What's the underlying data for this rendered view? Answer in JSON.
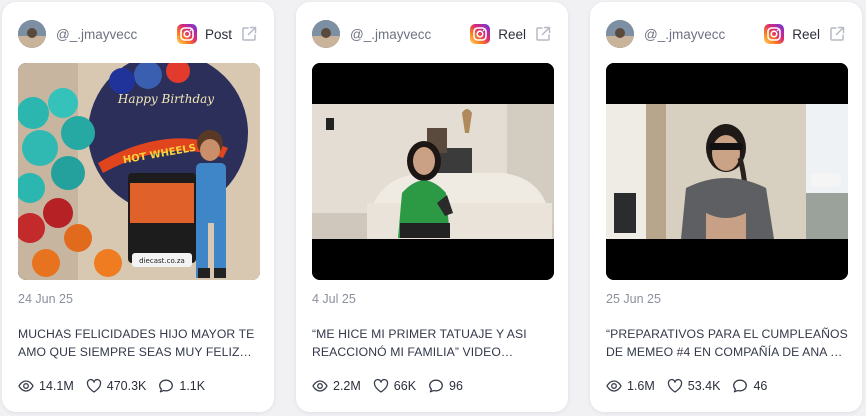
{
  "cards": [
    {
      "handle": "@_.jmayvecc",
      "type_label": "Post",
      "date": "24 Jun 25",
      "caption": "MUCHAS FELICIDADES HIJO MAYOR TE AMO QUE SIEMPRE SEAS MUY FELIZ COMO ERES...",
      "views": "14.1M",
      "likes": "470.3K",
      "comments": "1.1K",
      "media_text": "Happy Birthday",
      "media_text2": "HOT WHEELS"
    },
    {
      "handle": "@_.jmayvecc",
      "type_label": "Reel",
      "date": "4 Jul 25",
      "caption": "“ME HICE MI PRIMER TATUAJE Y ASI REACCIONÓ MI FAMILIA” VIDEO DISPONIBLE...",
      "views": "2.2M",
      "likes": "66K",
      "comments": "96"
    },
    {
      "handle": "@_.jmayvecc",
      "type_label": "Reel",
      "date": "25 Jun 25",
      "caption": "“PREPARATIVOS PARA EL CUMPLEAÑOS DE MEMEO #4 EN COMPAÑÍA DE ANA Y ERICK...",
      "views": "1.6M",
      "likes": "53.4K",
      "comments": "46"
    }
  ],
  "icons": {
    "platform": "instagram-icon",
    "external": "external-link-icon",
    "views": "eye-icon",
    "likes": "heart-icon",
    "comments": "comment-icon"
  },
  "colors": {
    "instagram_gradient": [
      "#feda75",
      "#fa7e1e",
      "#d62976",
      "#962fbf",
      "#4f5bd5"
    ],
    "text_muted": "#8b909c"
  }
}
